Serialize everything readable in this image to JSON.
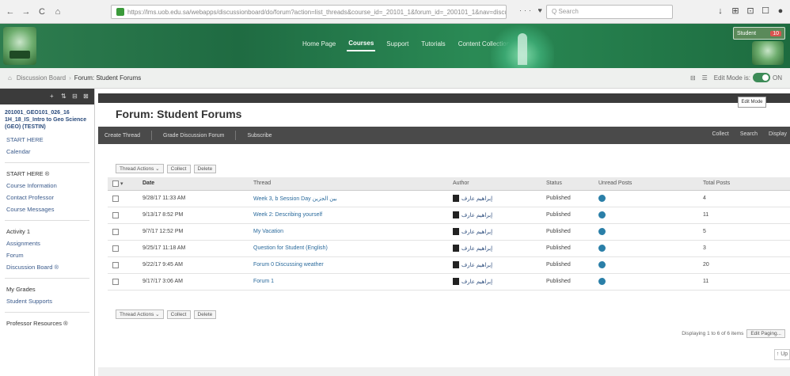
{
  "browser": {
    "nav": [
      "←",
      "→",
      "C",
      "⌂"
    ],
    "url": "https://lms.uob.edu.sa/webapps/discussionboard/do/forum?action=list_threads&course_id=_20101_1&forum_id=_200101_1&nav=discussion_board_entry",
    "url_actions": "··· ♥ ☆",
    "search_placeholder": "Q  Search",
    "tools": [
      "↓",
      "⊞",
      "⊡",
      "☐",
      "●"
    ]
  },
  "banner": {
    "tabs": [
      "Home Page",
      "Courses",
      "Support",
      "Tutorials",
      "Content Collection"
    ],
    "active_tab": "Courses",
    "user_label": "Student",
    "user_badge": "10"
  },
  "breadcrumb": {
    "home": "⌂",
    "parent": "Discussion Board",
    "current": "Forum: Student Forums",
    "right_icons": [
      "⊟",
      "☰"
    ],
    "edit_mode_label": "Edit Mode is:",
    "edit_mode_state": "ON"
  },
  "course_menu": {
    "toolbar_icons": [
      "+",
      "⇅",
      "⊟",
      "⊠"
    ],
    "course_title": "201001_GEO101_026_16 1H_18_IS_Intro to Geo Science (GEO) (TESTIN)",
    "items": [
      {
        "label": "START HERE",
        "group": 1
      },
      {
        "label": "Calendar",
        "group": 1
      },
      {
        "label": "START HERE ®",
        "group": 2
      },
      {
        "label": "Course Information",
        "group": 2
      },
      {
        "label": "Contact Professor",
        "group": 2
      },
      {
        "label": "Course Messages",
        "group": 2
      },
      {
        "label": "Activity 1",
        "group": 3
      },
      {
        "label": "Assignments",
        "group": 3
      },
      {
        "label": "Forum",
        "group": 3
      },
      {
        "label": "Discussion Board ®",
        "group": 3
      },
      {
        "label": "My Grades",
        "group": 4
      },
      {
        "label": "Student Supports",
        "group": 4
      },
      {
        "label": "Professor Resources ®",
        "group": 5
      }
    ]
  },
  "page": {
    "edit_mode_btn": "Edit Mode",
    "title": "Forum: Student Forums",
    "actions_left": [
      "Create Thread",
      "Grade Discussion Forum",
      "Subscribe"
    ],
    "actions_right": [
      "Collect",
      "Search",
      "Display"
    ],
    "bulk_actions": [
      "Thread Actions ⌄",
      "Collect",
      "Delete"
    ]
  },
  "table": {
    "columns": [
      "",
      "Date",
      "Thread",
      "Author",
      "Status",
      "Unread Posts",
      "Total Posts"
    ],
    "rows": [
      {
        "date": "9/28/17 11:33 AM",
        "thread": "Week 3, b Session Day بين الجزين",
        "author": "إبراهيم عارف",
        "status": "Published",
        "total": "4"
      },
      {
        "date": "9/13/17 8:52 PM",
        "thread": "Week 2: Describing yourself",
        "author": "إبراهيم عارف",
        "status": "Published",
        "total": "11"
      },
      {
        "date": "9/7/17 12:52 PM",
        "thread": "My Vacation",
        "author": "إبراهيم عارف",
        "status": "Published",
        "total": "5"
      },
      {
        "date": "9/25/17 11:18 AM",
        "thread": "Question for Student (English)",
        "author": "إبراهيم عارف",
        "status": "Published",
        "total": "3"
      },
      {
        "date": "9/22/17 9:45 AM",
        "thread": "Forum 0 Discussing weather",
        "author": "إبراهيم عارف",
        "status": "Published",
        "total": "20"
      },
      {
        "date": "9/17/17 3:06 AM",
        "thread": "Forum 1",
        "author": "إبراهيم عارف",
        "status": "Published",
        "total": "11"
      }
    ]
  },
  "paging": {
    "summary": "Displaying 1 to 6 of 6 items",
    "show_all": "Edit Paging..."
  },
  "page_arrow": "↑ Up",
  "colors": {
    "banner_green": "#2e7d4f",
    "toolbar_dark": "#3b3b3b",
    "unread_blue": "#2a7fa8",
    "link_blue": "#2a6a9c"
  }
}
